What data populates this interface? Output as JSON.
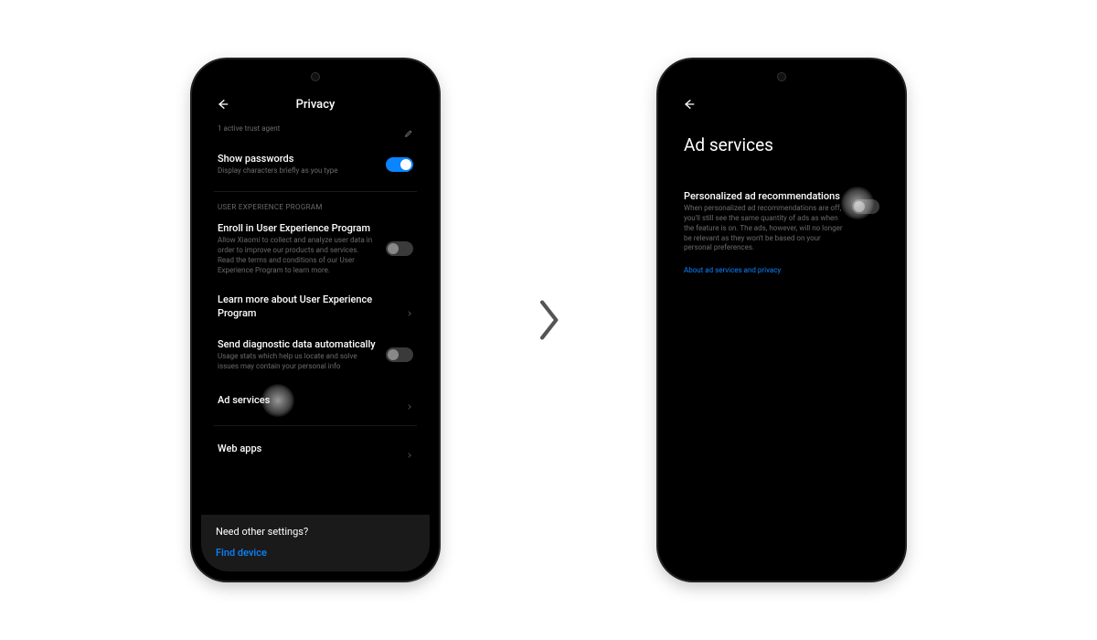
{
  "left": {
    "title": "Privacy",
    "trust_agent_sub": "1 active trust agent",
    "show_passwords": {
      "title": "Show passwords",
      "desc": "Display characters briefly as you type",
      "on": true
    },
    "section_label": "USER EXPERIENCE PROGRAM",
    "enroll": {
      "title": "Enroll in User Experience Program",
      "desc": "Allow Xiaomi to collect and analyze user data in order to improve our products and services. Read the terms and conditions of our User Experience Program to learn more.",
      "on": false
    },
    "learn_more": {
      "title": "Learn more about User Experience Program"
    },
    "diagnostic": {
      "title": "Send diagnostic data automatically",
      "desc": "Usage stats which help us locate and solve issues may contain your personal info",
      "on": false
    },
    "ad_services": {
      "title": "Ad services"
    },
    "web_apps": {
      "title": "Web apps"
    },
    "footer": {
      "title": "Need other settings?",
      "link": "Find device"
    }
  },
  "right": {
    "title": "Ad services",
    "personalized": {
      "title": "Personalized ad recommendations",
      "desc": "When personalized ad recommendations are off, you'll still see the same quantity of ads as when the feature is on. The ads, however, will no longer be relevant as they won't be based on your personal preferences.",
      "on": false
    },
    "about_link": "About ad services and privacy"
  }
}
